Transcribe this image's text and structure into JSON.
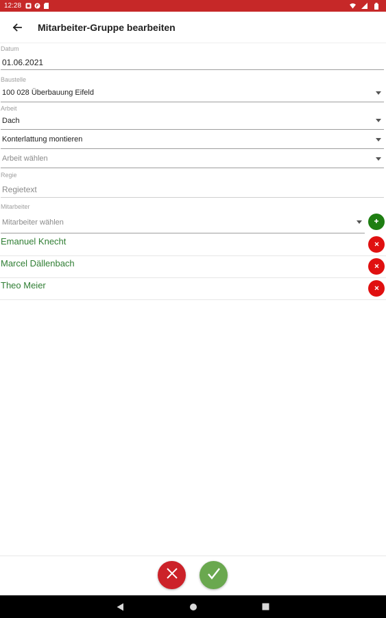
{
  "status_bar": {
    "time": "12:28",
    "icons_left": [
      "notification-icon",
      "app-icon",
      "sd-card-icon"
    ],
    "icons_right": [
      "wifi-icon",
      "signal-icon",
      "battery-icon"
    ]
  },
  "app_bar": {
    "back_icon": "arrow-left-icon",
    "title": "Mitarbeiter-Gruppe bearbeiten"
  },
  "form": {
    "datum_label": "Datum",
    "datum_value": "01.06.2021",
    "baustelle_label": "Baustelle",
    "baustelle_value": "100 028 Überbauung Eifeld",
    "arbeit_label": "Arbeit",
    "arbeit_1_value": "Dach",
    "arbeit_2_value": "Konterlattung montieren",
    "arbeit_3_placeholder": "Arbeit wählen",
    "regie_label": "Regie",
    "regie_placeholder": "Regietext",
    "mitarbeiter_label": "Mitarbeiter",
    "mitarbeiter_placeholder": "Mitarbeiter wählen",
    "add_icon": "plus-icon"
  },
  "employees": [
    {
      "name": "Emanuel Knecht"
    },
    {
      "name": "Marcel Dällenbach"
    },
    {
      "name": "Theo Meier"
    }
  ],
  "actions": {
    "cancel_icon": "close-icon",
    "confirm_icon": "check-icon"
  },
  "colors": {
    "status_bar": "#c62828",
    "employee_text": "#2e7d32",
    "remove": "#e01010",
    "add": "#1e7e12",
    "cancel": "#cc2229",
    "confirm": "#6aa84f"
  },
  "nav_bar": {
    "icons": [
      "back-triangle-icon",
      "home-circle-icon",
      "recents-square-icon"
    ]
  }
}
